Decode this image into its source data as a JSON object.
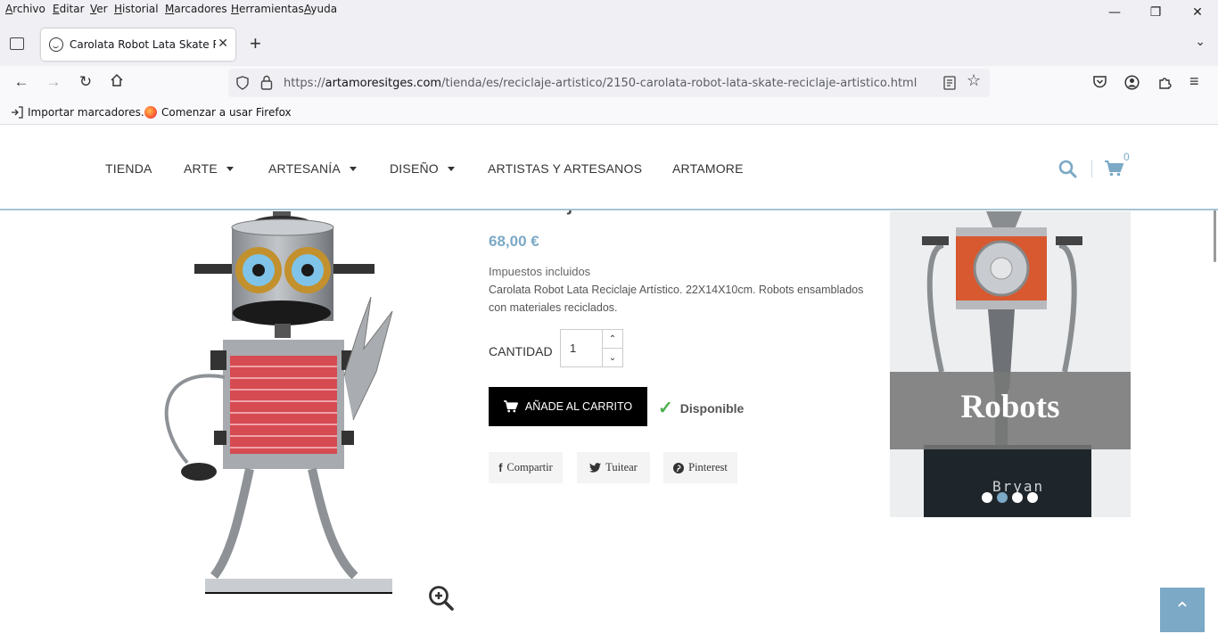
{
  "menubar": {
    "items": [
      "Archivo",
      "Editar",
      "Ver",
      "Historial",
      "Marcadores",
      "Herramientas",
      "Ayuda"
    ]
  },
  "tab": {
    "title": "Carolata Robot Lata Skate Reciclaje Artístico",
    "favicon": "smiley-icon"
  },
  "urlbar": {
    "prefix": "https://",
    "domain": "artamoresitges.com",
    "path": "/tienda/es/reciclaje-artistico/2150-carolata-robot-lata-skate-reciclaje-artistico.html"
  },
  "bookmarks": [
    {
      "label": "Importar marcadores...",
      "icon": "import-icon"
    },
    {
      "label": "Comenzar a usar Firefox",
      "icon": "firefox-icon"
    }
  ],
  "site_nav": {
    "items": [
      "TIENDA",
      "ARTE",
      "ARTESANÍA",
      "DISEÑO",
      "ARTISTAS Y ARTESANOS",
      "ARTAMORE"
    ],
    "cart_count": "0"
  },
  "product": {
    "title_partial": "Reciclaje Artístico",
    "price": "68,00 €",
    "tax_note": "Impuestos incluidos",
    "description": "Carolata Robot Lata Reciclaje Artístico.  22X14X10cm. Robots ensamblados con materiales reciclados.",
    "quantity_label": "CANTIDAD",
    "quantity_value": "1",
    "add_to_cart": "AÑADE AL CARRITO",
    "availability": "Disponible"
  },
  "share": {
    "facebook": "Compartir",
    "twitter": "Tuitear",
    "pinterest": "Pinterest"
  },
  "banner": {
    "caption": "Robots",
    "plate_text": "Bryan",
    "slides": 4,
    "active_slide": 1
  },
  "colors": {
    "accent": "#7ba9c6",
    "cart_button": "#000000",
    "available": "#4caf50"
  }
}
